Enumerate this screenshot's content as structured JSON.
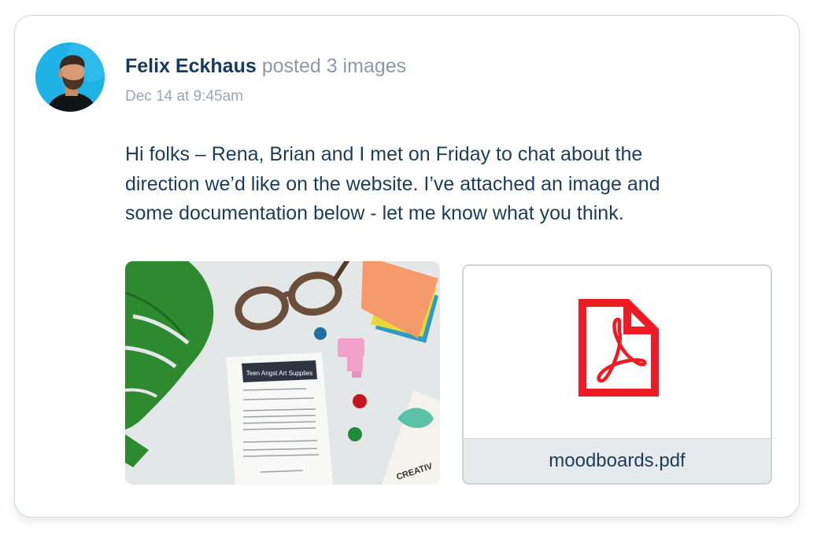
{
  "post": {
    "author": "Felix Eckhaus",
    "action": "posted 3 images",
    "timestamp": "Dec 14 at 9:45am",
    "body_line1": "Hi folks – Rena, Brian and I met on Friday to chat about the",
    "body_line2": "direction we’d like on the website. I’ve attached an image and",
    "body_line3": "some documentation below - let me know what you think."
  },
  "attachments": {
    "photo": {
      "receipt_store": "Teen Angst Art Supplies",
      "receipt_card_text": "CREATIV"
    },
    "file": {
      "name": "moodboards.pdf",
      "icon": "pdf-icon"
    }
  },
  "colors": {
    "author": "#17395c",
    "muted": "#8c9aa8",
    "body_text": "#1c3d5a",
    "pdf_red": "#ee1b24",
    "avatar_bg": "#1eb2e6"
  }
}
